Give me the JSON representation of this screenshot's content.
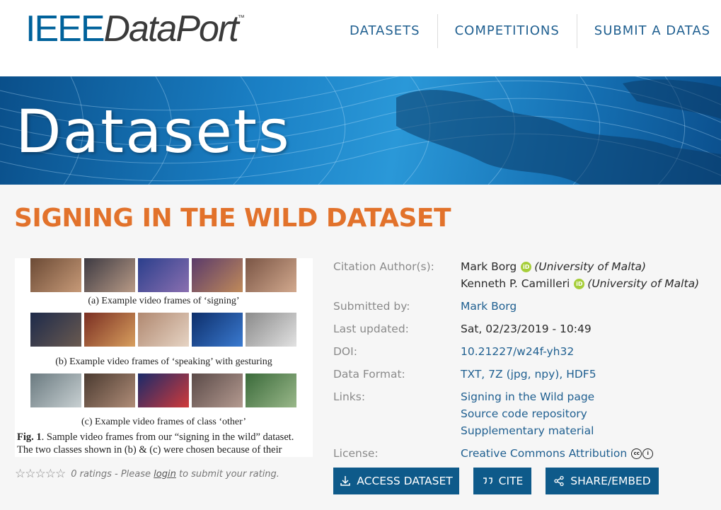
{
  "header": {
    "logo_ieee": "IEEE",
    "logo_dataport": "DataPort",
    "logo_tm": "™",
    "nav": [
      {
        "label": "DATASETS"
      },
      {
        "label": "COMPETITIONS"
      },
      {
        "label": "SUBMIT A DATAS"
      }
    ]
  },
  "banner": {
    "title": "Datasets"
  },
  "dataset": {
    "title": "SIGNING IN THE WILD DATASET",
    "figure": {
      "caption_a": "(a) Example video frames of ‘signing’",
      "caption_b": "(b) Example video frames of ‘speaking’ with gesturing",
      "caption_c": "(c) Example video frames of class ‘other’",
      "fig_label": "Fig. 1",
      "fig_line1_rest": ". Sample video frames from our “signing in the wild” dataset.",
      "fig_line2": "The two classes shown in (b) & (c) were chosen because of their"
    },
    "rating": {
      "stars": "☆☆☆☆☆",
      "count_text": "0 ratings - Please ",
      "login_label": "login",
      "suffix": " to submit your rating."
    },
    "meta": {
      "authors_label": "Citation Author(s):",
      "authors": [
        {
          "name": "Mark Borg",
          "affiliation": "(University of Malta)"
        },
        {
          "name": "Kenneth P. Camilleri",
          "affiliation": "(University of Malta)"
        }
      ],
      "orcid_icon": "iD",
      "submitted_label": "Submitted by:",
      "submitted_by": "Mark Borg",
      "updated_label": "Last updated:",
      "updated": "Sat, 02/23/2019 - 10:49",
      "doi_label": "DOI:",
      "doi": "10.21227/w24f-yh32",
      "format_label": "Data Format:",
      "formats": [
        "TXT",
        "7Z (jpg, npy)",
        "HDF5"
      ],
      "links_label": "Links:",
      "links": [
        "Signing in the Wild page",
        "Source code repository",
        "Supplementary material"
      ],
      "license_label": "License:",
      "license": "Creative Commons Attribution",
      "cc_icon": "cc",
      "by_icon": "i"
    },
    "buttons": {
      "access": "ACCESS DATASET",
      "cite": "CITE",
      "share": "SHARE/EMBED"
    }
  },
  "colors": {
    "brand_blue": "#00629b",
    "title_orange": "#e2722b",
    "button_blue": "#0e5a8a",
    "orcid_green": "#a6ce39"
  }
}
